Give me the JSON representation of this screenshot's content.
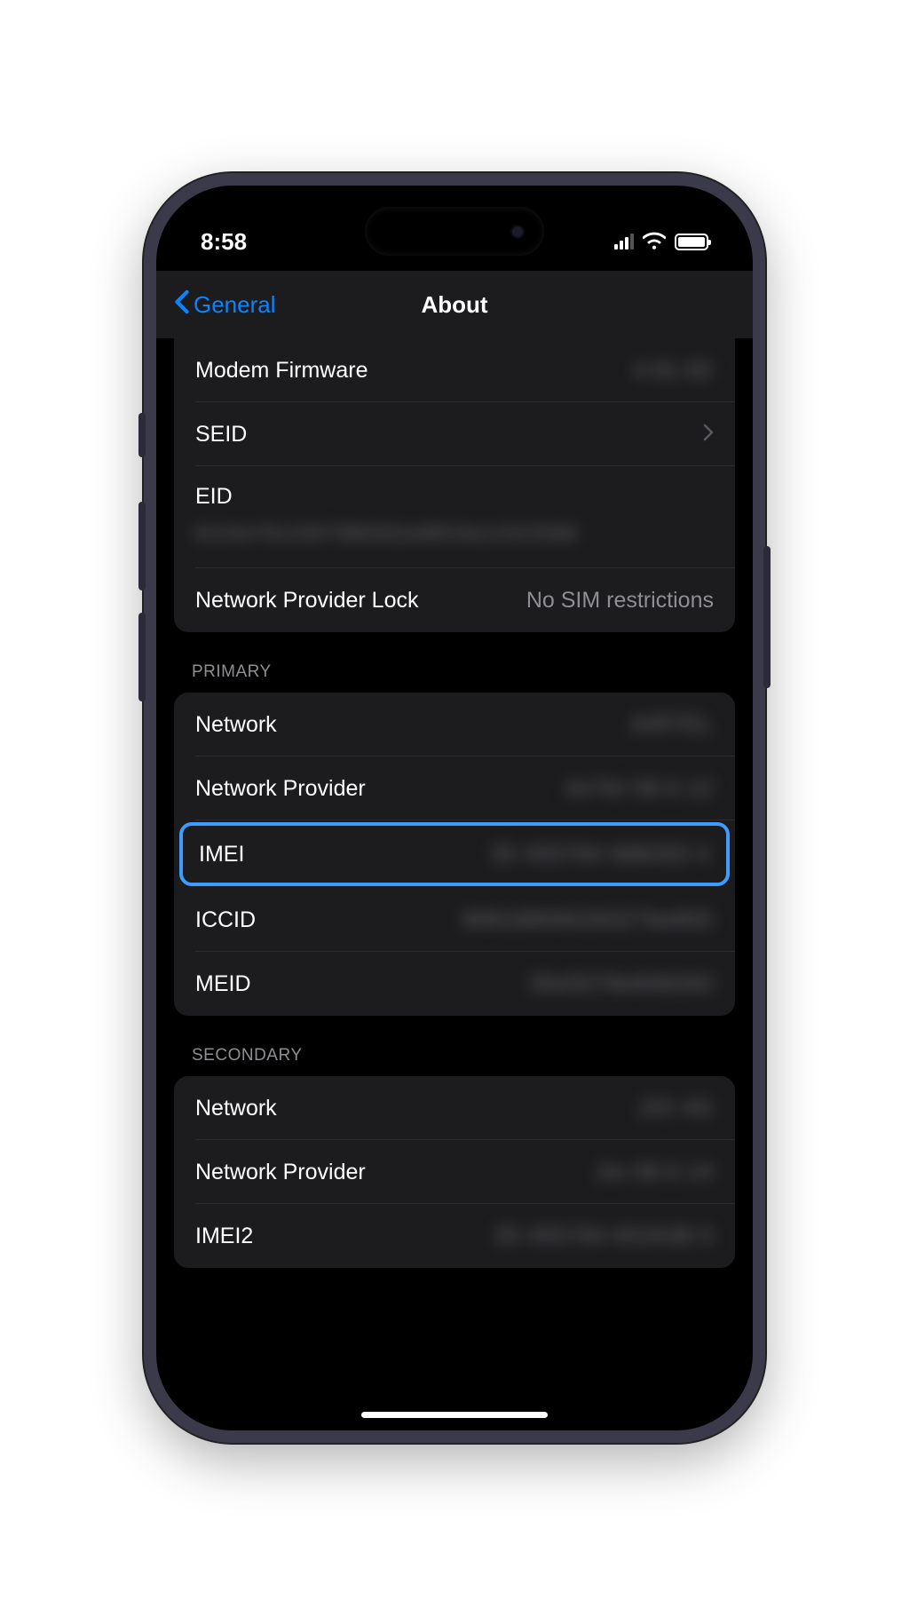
{
  "statusBar": {
    "time": "8:58"
  },
  "nav": {
    "backLabel": "General",
    "title": "About"
  },
  "sectionTop": {
    "rows": [
      {
        "label": "Modem Firmware",
        "value": "4.81.82",
        "blurred": true
      },
      {
        "label": "SEID",
        "chevron": true
      },
      {
        "label": "EID",
        "value": "8104e7813367986582e88f18a13323588",
        "blurred": true,
        "stacked": true
      },
      {
        "label": "Network Provider Lock",
        "value": "No SIM restrictions"
      }
    ]
  },
  "primary": {
    "header": "PRIMARY",
    "rows": [
      {
        "label": "Network",
        "value": "AIRTEL",
        "blurred": true
      },
      {
        "label": "Network Provider",
        "value": "AirTel 58.5.12",
        "blurred": true
      },
      {
        "label": "IMEI",
        "value": "35 455784 668283 4",
        "blurred": true,
        "highlighted": true
      },
      {
        "label": "ICCID",
        "value": "89918809428327be855",
        "blurred": true
      },
      {
        "label": "MEID",
        "value": "35e5578e668283",
        "blurred": true
      }
    ]
  },
  "secondary": {
    "header": "SECONDARY",
    "rows": [
      {
        "label": "Network",
        "value": "JIO 4G",
        "blurred": true
      },
      {
        "label": "Network Provider",
        "value": "Jio 58.5.14",
        "blurred": true
      },
      {
        "label": "IMEI2",
        "value": "35 455784 653438 5",
        "blurred": true
      }
    ]
  }
}
